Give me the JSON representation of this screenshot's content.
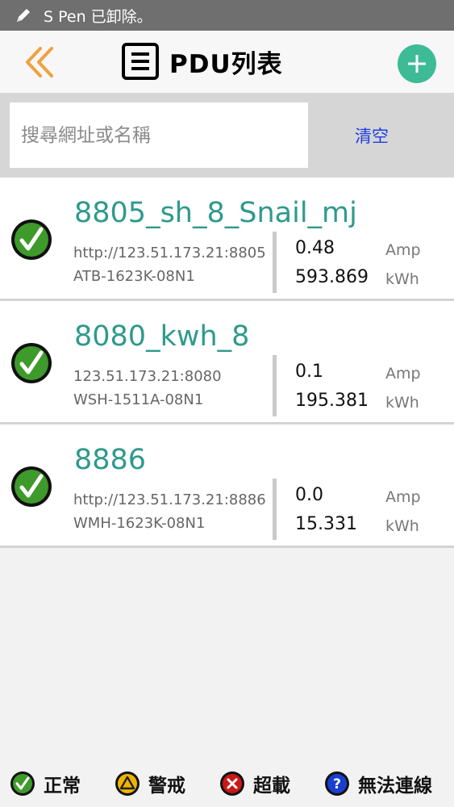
{
  "status_bar": {
    "notice": "S Pen 已卸除。"
  },
  "header": {
    "title": "PDU列表"
  },
  "search": {
    "placeholder": "搜尋網址或名稱",
    "clear_label": "清空"
  },
  "pdus": [
    {
      "name": "8805_sh_8_Snail_mj",
      "url": "http://123.51.173.21:8805",
      "model": "ATB-1623K-08N1",
      "amp": "0.48",
      "kwh": "593.869",
      "amp_unit": "Amp",
      "kwh_unit": "kWh",
      "status": "normal"
    },
    {
      "name": "8080_kwh_8",
      "url": "123.51.173.21:8080",
      "model": "WSH-1511A-08N1",
      "amp": "0.1",
      "kwh": "195.381",
      "amp_unit": "Amp",
      "kwh_unit": "kWh",
      "status": "normal"
    },
    {
      "name": "8886",
      "url": "http://123.51.173.21:8886",
      "model": "WMH-1623K-08N1",
      "amp": "0.0",
      "kwh": "15.331",
      "amp_unit": "Amp",
      "kwh_unit": "kWh",
      "status": "normal"
    }
  ],
  "legend": [
    {
      "label": "正常",
      "icon": "check-circle-icon",
      "color": "#2e7d1e"
    },
    {
      "label": "警戒",
      "icon": "warning-circle-icon",
      "color": "#f0b400"
    },
    {
      "label": "超載",
      "icon": "x-circle-icon",
      "color": "#c81818"
    },
    {
      "label": "無法連線",
      "icon": "question-circle-icon",
      "color": "#1a3fd0"
    }
  ],
  "colors": {
    "accent": "#3dbb96",
    "back": "#f0a040",
    "name": "#2e9a8c",
    "link": "#1e3ee0"
  }
}
